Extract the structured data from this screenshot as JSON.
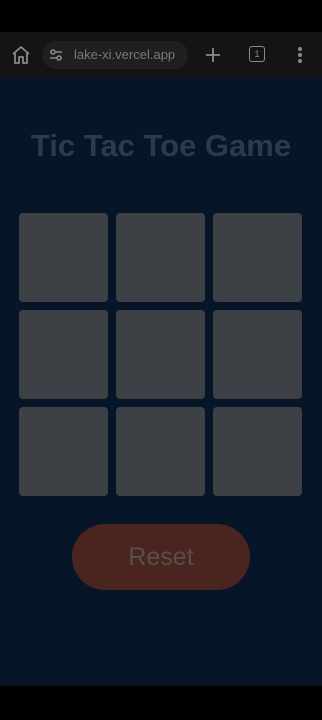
{
  "browser": {
    "url": "lake-xi.vercel.app",
    "tab_count": "1",
    "icons": [
      "home-icon",
      "site-info-icon",
      "plus-icon",
      "tab-switcher-icon",
      "more-vert-icon"
    ]
  },
  "game": {
    "title": "Tic Tac Toe Game",
    "cells": [
      "",
      "",
      "",
      "",
      "",
      "",
      "",
      "",
      ""
    ],
    "reset_label": "Reset"
  },
  "colors": {
    "page_background": "#061628",
    "title": "#2c3b48",
    "cell": "#3d4145",
    "reset_button": "#4a2520",
    "reset_text": "#5a4e4c"
  }
}
